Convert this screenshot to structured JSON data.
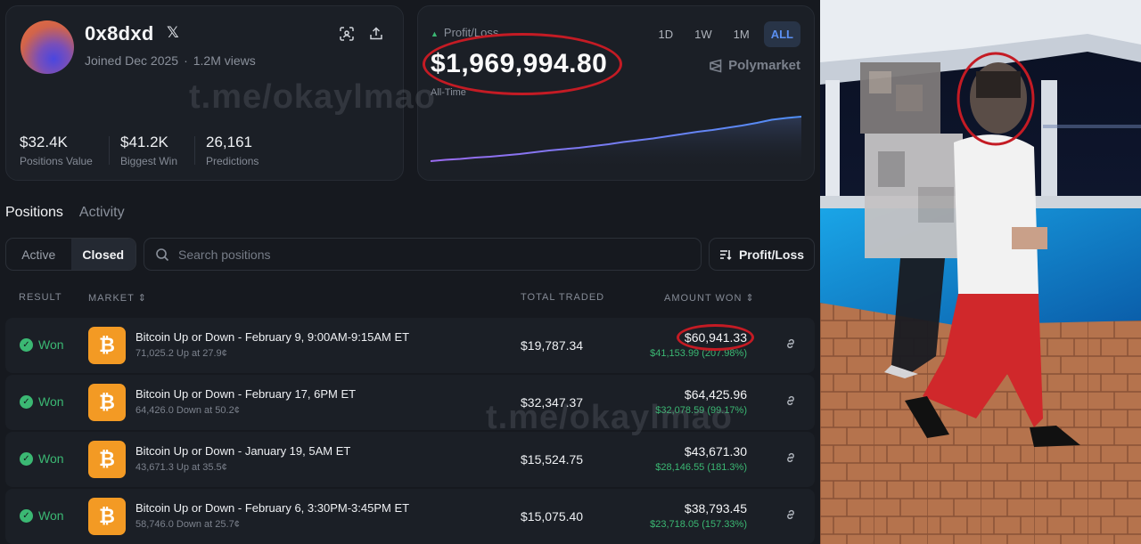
{
  "profile": {
    "username": "0x8dxd",
    "joined": "Joined Dec 2025",
    "views": "1.2M views",
    "stats": [
      {
        "value": "$32.4K",
        "label": "Positions Value"
      },
      {
        "value": "$41.2K",
        "label": "Biggest Win"
      },
      {
        "value": "26,161",
        "label": "Predictions"
      }
    ]
  },
  "pnl": {
    "label": "Profit/Loss",
    "value": "$1,969,994.80",
    "period": "All-Time",
    "ranges": [
      "1D",
      "1W",
      "1M",
      "ALL"
    ],
    "active_range": "ALL",
    "brand": "Polymarket",
    "accent": "#5b8ff0",
    "series": [
      0.0,
      0.03,
      0.05,
      0.08,
      0.1,
      0.13,
      0.16,
      0.2,
      0.24,
      0.27,
      0.3,
      0.34,
      0.38,
      0.43,
      0.47,
      0.51,
      0.56,
      0.61,
      0.66,
      0.7,
      0.75,
      0.8,
      0.86,
      0.93,
      0.97,
      1.0
    ]
  },
  "tabs": [
    "Positions",
    "Activity"
  ],
  "filters": {
    "active_label": "Active",
    "closed_label": "Closed",
    "search_placeholder": "Search positions",
    "sort_label": "Profit/Loss"
  },
  "table": {
    "headers": {
      "result": "RESULT",
      "market": "MARKET",
      "traded": "TOTAL TRADED",
      "won": "AMOUNT WON"
    },
    "rows": [
      {
        "result": "Won",
        "title": "Bitcoin Up or Down - February 9, 9:00AM-9:15AM ET",
        "sub": "71,025.2 Up at 27.9¢",
        "traded": "$19,787.34",
        "amount": "$60,941.33",
        "profit": "$41,153.99 (207.98%)"
      },
      {
        "result": "Won",
        "title": "Bitcoin Up or Down - February 17, 6PM ET",
        "sub": "64,426.0 Down at 50.2¢",
        "traded": "$32,347.37",
        "amount": "$64,425.96",
        "profit": "$32,078.59 (99.17%)"
      },
      {
        "result": "Won",
        "title": "Bitcoin Up or Down - January 19, 5AM ET",
        "sub": "43,671.3 Up at 35.5¢",
        "traded": "$15,524.75",
        "amount": "$43,671.30",
        "profit": "$28,146.55 (181.3%)"
      },
      {
        "result": "Won",
        "title": "Bitcoin Up or Down - February 6, 3:30PM-3:45PM ET",
        "sub": "58,746.0 Down at 25.7¢",
        "traded": "$15,075.40",
        "amount": "$38,793.45",
        "profit": "$23,718.05 (157.33%)"
      }
    ]
  },
  "watermark": "t.me/okaylmao",
  "colors": {
    "won_green": "#3bb873",
    "btc_orange": "#f39a24",
    "highlight_red": "#c41b24"
  }
}
